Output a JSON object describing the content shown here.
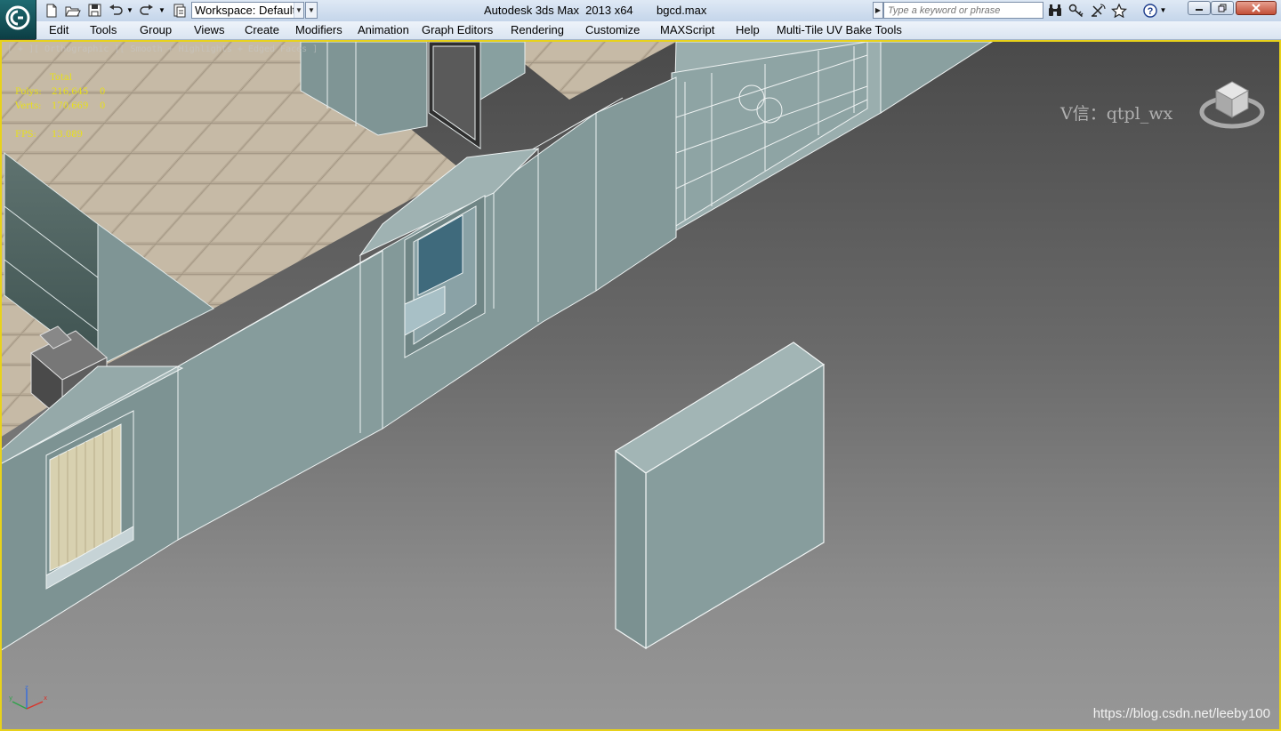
{
  "titlebar": {
    "app_title": "Autodesk 3ds Max  2013 x64",
    "file_name": "bgcd.max",
    "workspace_label": "Workspace: Default",
    "search_placeholder": "Type a keyword or phrase",
    "accent_color": "#1f6b72"
  },
  "menu": {
    "items": [
      {
        "label": "Edit"
      },
      {
        "label": "Tools"
      },
      {
        "label": "Group"
      },
      {
        "label": "Views"
      },
      {
        "label": "Create"
      },
      {
        "label": "Modifiers"
      },
      {
        "label": "Animation"
      },
      {
        "label": "Graph Editors"
      },
      {
        "label": "Rendering"
      },
      {
        "label": "Customize"
      },
      {
        "label": "MAXScript"
      },
      {
        "label": "Help"
      },
      {
        "label": "Multi-Tile UV Bake Tools"
      }
    ]
  },
  "viewport": {
    "label": "[ + ][ Orthographic ][ Smooth + Highlights + Edged Faces ]",
    "stats_header": "Total",
    "polys_label": "Polys:",
    "polys_value": "216,645",
    "polys_selected": "0",
    "verts_label": "Verts:",
    "verts_value": "170,669",
    "verts_selected": "0",
    "fps_label": "FPS:",
    "fps_value": "13.089",
    "stats_color": "#e8e01a",
    "border_color": "#e8d21a"
  },
  "overlays": {
    "watermark": "V信：qtpl_wx",
    "csdn_url": "https://blog.csdn.net/leeby100"
  },
  "icons": {
    "logo": "3ds-max-logo-icon",
    "new": "new-file-icon",
    "open": "open-file-icon",
    "save": "save-icon",
    "undo": "undo-icon",
    "redo": "redo-icon",
    "project": "project-folder-icon",
    "search": "binoculars-icon",
    "subscription": "key-icon",
    "communication": "satellite-icon",
    "favorites": "star-icon",
    "help": "help-icon"
  }
}
